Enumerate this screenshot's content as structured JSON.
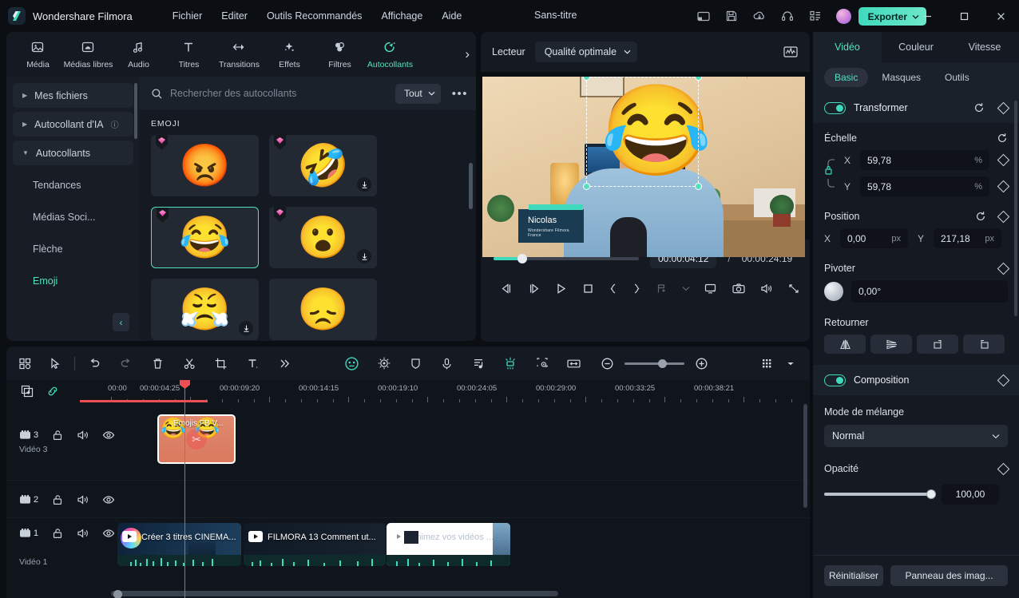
{
  "titlebar": {
    "brand": "Wondershare Filmora",
    "menus": [
      "Fichier",
      "Editer",
      "Outils Recommandés",
      "Affichage",
      "Aide"
    ],
    "document_title": "Sans-titre",
    "icons": [
      "layout-icon",
      "save-icon",
      "cloud-upload-icon",
      "headset-icon",
      "apps-grid-icon",
      "avatar"
    ],
    "export_label": "Exporter",
    "window_controls": [
      "minimize-icon",
      "maximize-icon",
      "close-icon"
    ]
  },
  "tooltabs": [
    {
      "label": "Média",
      "icon": "media-icon"
    },
    {
      "label": "Médias libres",
      "icon": "stock-media-icon"
    },
    {
      "label": "Audio",
      "icon": "audio-icon"
    },
    {
      "label": "Titres",
      "icon": "titles-icon"
    },
    {
      "label": "Transitions",
      "icon": "transitions-icon"
    },
    {
      "label": "Effets",
      "icon": "effects-icon"
    },
    {
      "label": "Filtres",
      "icon": "filters-icon"
    },
    {
      "label": "Autocollants",
      "icon": "stickers-icon"
    }
  ],
  "tooltabs_active_index": 7,
  "library": {
    "nav_groups": [
      {
        "label": "Mes fichiers",
        "expanded": false
      },
      {
        "label": "Autocollant d'IA",
        "expanded": false,
        "help": "?"
      },
      {
        "label": "Autocollants",
        "expanded": true
      }
    ],
    "nav_subitems": [
      "Tendances",
      "Médias Soci...",
      "Flèche",
      "Emoji"
    ],
    "nav_active": "Emoji",
    "search_placeholder": "Rechercher des autocollants",
    "search_value": "",
    "filter_label": "Tout",
    "more_label": "•••",
    "section_title": "EMOJI",
    "stickers": [
      {
        "emoji": "😡",
        "premium": true,
        "downloadable": false,
        "selected": false
      },
      {
        "emoji": "🤣",
        "premium": true,
        "downloadable": true,
        "selected": false
      },
      {
        "emoji": "😂",
        "premium": true,
        "downloadable": false,
        "selected": true
      },
      {
        "emoji": "😮",
        "premium": true,
        "downloadable": true,
        "selected": false
      },
      {
        "emoji": "😤",
        "premium": false,
        "downloadable": true,
        "selected": false
      },
      {
        "emoji": "😞",
        "premium": false,
        "downloadable": false,
        "selected": false
      }
    ]
  },
  "preview": {
    "player_label": "Lecteur",
    "quality_label": "Qualité optimale",
    "scope_icon": "waveform-scope-icon",
    "overlay_emoji": "😂",
    "lower_third_name": "Nicolas",
    "lower_third_subtitle": "Wondershare Filmora France",
    "current_time": "00:00:04:12",
    "time_separator": "/",
    "total_time": "00:00:24:19",
    "progress_percent": 18,
    "buttons": [
      "prev-frame-icon",
      "next-frame-icon",
      "play-icon",
      "stop-icon",
      "mark-in-icon",
      "mark-out-icon",
      "add-marker-icon",
      "chevron-down-icon",
      "screen-icon",
      "snapshot-icon",
      "volume-icon",
      "fullscreen-icon"
    ]
  },
  "properties": {
    "tabs": [
      "Vidéo",
      "Couleur",
      "Vitesse"
    ],
    "tabs_active": "Vidéo",
    "subtabs": [
      "Basic",
      "Masques",
      "Outils"
    ],
    "subtabs_active": "Basic",
    "transform": {
      "title": "Transformer",
      "enabled": true,
      "scale_label": "Échelle",
      "scale_x": "59,78",
      "scale_y": "59,78",
      "scale_unit": "%",
      "lock_icon": "link-lock-icon",
      "position_label": "Position",
      "position_x": "0,00",
      "position_y": "217,18",
      "position_unit": "px",
      "axis_x": "X",
      "axis_y": "Y",
      "rotate_label": "Pivoter",
      "rotate_value": "0,00°",
      "flip_label": "Retourner",
      "flip_buttons": [
        "flip-horizontal-icon",
        "flip-vertical-icon",
        "rotate-right-icon",
        "rotate-left-icon"
      ]
    },
    "composition": {
      "title": "Composition",
      "enabled": true,
      "blend_label": "Mode de mélange",
      "blend_value": "Normal",
      "opacity_label": "Opacité",
      "opacity_value": "100,00",
      "opacity_percent": 100
    },
    "footer": {
      "reset_label": "Réinitialiser",
      "panel_label": "Panneau des imag..."
    }
  },
  "timeline": {
    "toolbar_left": [
      "grid-view-icon",
      "selection-tool-icon",
      "undo-icon",
      "redo-icon",
      "delete-icon",
      "split-icon",
      "crop-icon",
      "text-icon",
      "more-icon"
    ],
    "toolbar_center": [
      "emoji-mask-icon",
      "color-match-icon",
      "shield-icon",
      "microphone-icon",
      "audio-stretch-icon",
      "green-screen-icon",
      "motion-track-icon",
      "fit-icon"
    ],
    "zoom_out_icon": "zoom-out-icon",
    "zoom_in_icon": "zoom-in-icon",
    "zoom_percent": 55,
    "render_icon": "render-bar-icon",
    "dropdown_icon": "chevron-down-icon",
    "header_icons": [
      "add-track-icon",
      "link-icon"
    ],
    "ruler_labels": [
      "00:00",
      "00:00:04:25",
      "00:00:09:20",
      "00:00:14:15",
      "00:00:19:10",
      "00:00:24:05",
      "00:00:29:00",
      "00:00:33:25",
      "00:00:38:21"
    ],
    "playhead_time": "00:00:04:12",
    "tracks": [
      {
        "num": "3",
        "name": "Vidéo 3",
        "locked": false,
        "muted": false,
        "visible": true
      },
      {
        "num": "2",
        "name": "",
        "locked": false,
        "muted": false,
        "visible": true
      },
      {
        "num": "1",
        "name": "Vidéo 1",
        "locked": false,
        "muted": false,
        "visible": true
      }
    ],
    "clips": [
      {
        "track": 3,
        "label": "Emojis FB V...",
        "type": "sticker",
        "selected": true,
        "emoji": "😂"
      },
      {
        "track": 1,
        "label": "Créer 3 titres CINEMA...",
        "type": "video",
        "selected": false
      },
      {
        "track": 1,
        "label": "FILMORA 13  Comment ut...",
        "type": "video",
        "selected": false
      },
      {
        "track": 1,
        "label": "Animez vos vidéos ...",
        "type": "video",
        "selected": false
      }
    ]
  }
}
